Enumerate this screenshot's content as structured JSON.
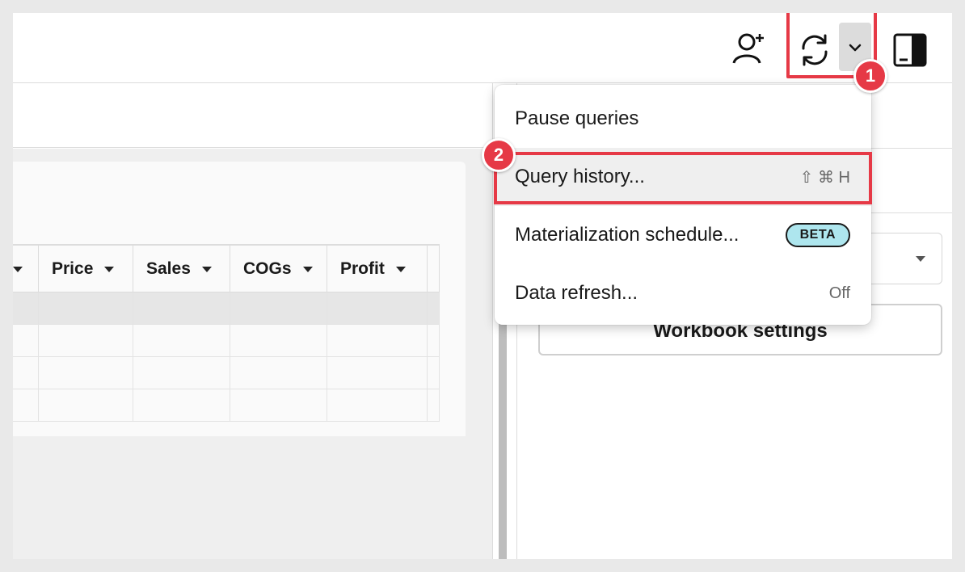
{
  "table": {
    "columns": [
      {
        "label": ""
      },
      {
        "label": "Price"
      },
      {
        "label": "Sales"
      },
      {
        "label": "COGs"
      },
      {
        "label": "Profit"
      }
    ]
  },
  "right_panel": {
    "workbook_settings_label": "Workbook settings"
  },
  "refresh_menu": {
    "items": [
      {
        "label": "Pause queries",
        "right": ""
      },
      {
        "label": "Query history...",
        "right": "⇧ ⌘ H"
      },
      {
        "label": "Materialization schedule...",
        "badge": "BETA"
      },
      {
        "label": "Data refresh...",
        "right": "Off"
      }
    ]
  },
  "callouts": {
    "step1": "1",
    "step2": "2"
  },
  "colors": {
    "callout_red": "#e63946",
    "beta_bg": "#aee6ee"
  },
  "icons": {
    "add_user": "add-user-icon",
    "refresh": "refresh-icon",
    "dropdown": "chevron-down-icon",
    "panel": "panel-toggle-icon"
  }
}
